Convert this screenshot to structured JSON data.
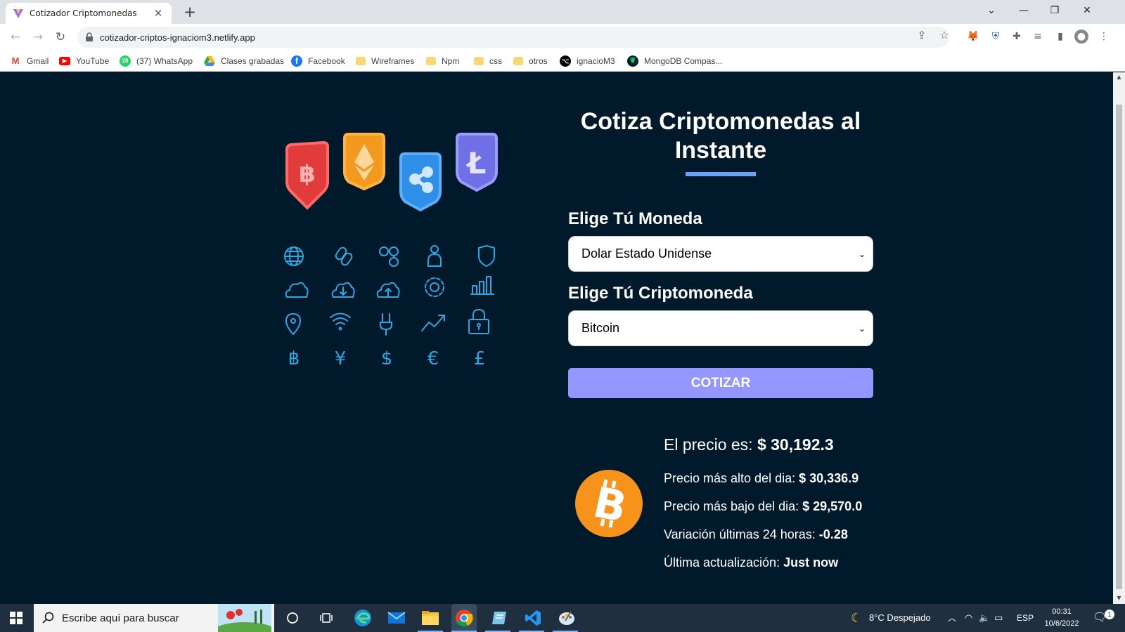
{
  "browser": {
    "tab_title": "Cotizador Criptomonedas",
    "url": "cotizador-criptos-ignaciom3.netlify.app"
  },
  "bookmarks": [
    {
      "label": "Gmail",
      "icon": "gmail-icon",
      "color": "#ea4335"
    },
    {
      "label": "YouTube",
      "icon": "youtube-icon",
      "color": "#ff0000"
    },
    {
      "label": "(37) WhatsApp",
      "icon": "whatsapp-icon",
      "color": "#25d366"
    },
    {
      "label": "Clases grabadas",
      "icon": "google-drive-icon",
      "color": "#fbbc04"
    },
    {
      "label": "Facebook",
      "icon": "facebook-icon",
      "color": "#1877f2"
    },
    {
      "label": "Wireframes",
      "icon": "folder-icon",
      "color": "#f8d775"
    },
    {
      "label": "Npm",
      "icon": "folder-icon",
      "color": "#f8d775"
    },
    {
      "label": "css",
      "icon": "folder-icon",
      "color": "#f8d775"
    },
    {
      "label": "otros",
      "icon": "folder-icon",
      "color": "#f8d775"
    },
    {
      "label": "ignacioM3",
      "icon": "github-icon",
      "color": "#000000"
    },
    {
      "label": "MongoDB Compas...",
      "icon": "mongodb-icon",
      "color": "#00684a"
    }
  ],
  "page": {
    "heading": "Cotiza Criptomonedas al Instante",
    "currency_label": "Elige Tú Moneda",
    "currency_value": "Dolar Estado Unidense",
    "crypto_label": "Elige Tú Criptomoneda",
    "crypto_value": "Bitcoin",
    "submit_label": "COTIZAR"
  },
  "result": {
    "price_label": "El precio es:",
    "price": "$ 30,192.3",
    "high_label": "Precio más alto del dia:",
    "high": "$ 30,336.9",
    "low_label": "Precio más bajo del dia:",
    "low": "$ 29,570.0",
    "change_label": "Variación últimas 24 horas:",
    "change": "-0.28",
    "updated_label": "Última actualización:",
    "updated": "Just now"
  },
  "taskbar": {
    "search_placeholder": "Escribe aquí para buscar",
    "weather": "8°C  Despejado",
    "language": "ESP",
    "time": "00:31",
    "date": "10/6/2022",
    "notifications": "1"
  },
  "colors": {
    "page_bg": "#00192b",
    "accent_bar": "#66a2fe",
    "button": "#9497ff",
    "bitcoin": "#f7931a"
  }
}
